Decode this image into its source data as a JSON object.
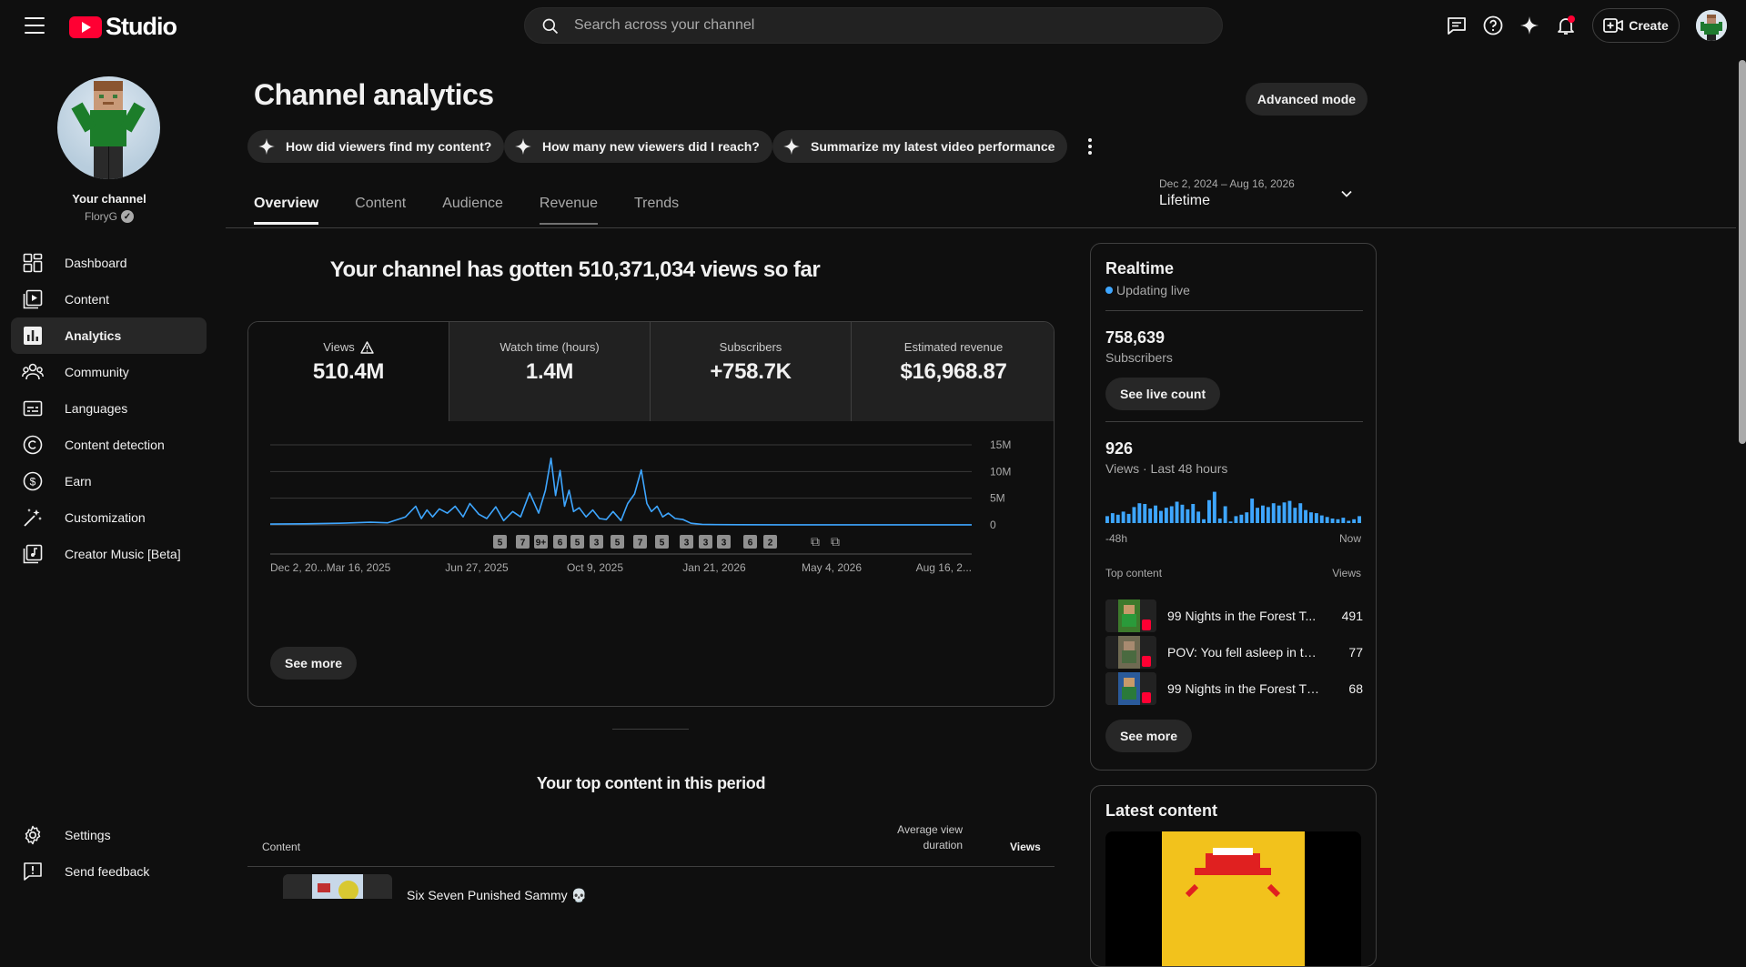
{
  "app": {
    "logo_text": "Studio",
    "search_placeholder": "Search across your channel",
    "create_label": "Create",
    "top_icons": [
      "comments-icon",
      "help-icon",
      "sparkle-icon",
      "notifications-icon"
    ]
  },
  "sidebar": {
    "channel_label": "Your channel",
    "channel_handle": "FloryG",
    "items": [
      {
        "label": "Dashboard",
        "icon": "dashboard-icon"
      },
      {
        "label": "Content",
        "icon": "content-icon"
      },
      {
        "label": "Analytics",
        "icon": "analytics-icon",
        "active": true
      },
      {
        "label": "Community",
        "icon": "community-icon"
      },
      {
        "label": "Languages",
        "icon": "languages-icon"
      },
      {
        "label": "Content detection",
        "icon": "copyright-icon"
      },
      {
        "label": "Earn",
        "icon": "earn-icon"
      },
      {
        "label": "Customization",
        "icon": "customization-icon"
      },
      {
        "label": "Creator Music [Beta]",
        "icon": "music-icon"
      }
    ],
    "bottom_items": [
      {
        "label": "Settings",
        "icon": "settings-icon"
      },
      {
        "label": "Send feedback",
        "icon": "feedback-icon"
      }
    ]
  },
  "main": {
    "title": "Channel analytics",
    "advanced_mode_label": "Advanced mode",
    "chips": [
      "How did viewers find my content?",
      "How many new viewers did I reach?",
      "Summarize my latest video performance"
    ],
    "date_range": {
      "range": "Dec 2, 2024 – Aug 16, 2026",
      "label": "Lifetime"
    },
    "tabs": [
      "Overview",
      "Content",
      "Audience",
      "Revenue",
      "Trends"
    ],
    "active_tab": "Overview",
    "headline": "Your channel has gotten 510,371,034 views so far",
    "metrics": [
      {
        "label": "Views",
        "value": "510.4M",
        "warning": true
      },
      {
        "label": "Watch time (hours)",
        "value": "1.4M"
      },
      {
        "label": "Subscribers",
        "value": "+758.7K"
      },
      {
        "label": "Estimated revenue",
        "value": "$16,968.87"
      }
    ],
    "see_more_label": "See more",
    "top_content_title": "Your top content in this period",
    "table": {
      "col_content": "Content",
      "col_avd_line1": "Average view",
      "col_avd_line2": "duration",
      "col_views": "Views",
      "first_row_title": "Six Seven Punished Sammy 💀"
    }
  },
  "realtime": {
    "title": "Realtime",
    "status": "Updating live",
    "subscribers_value": "758,639",
    "subscribers_label": "Subscribers",
    "see_live_label": "See live count",
    "views_value": "926",
    "views_label": "Views · Last 48 hours",
    "axis_start": "-48h",
    "axis_end": "Now",
    "bars": [
      0.18,
      0.26,
      0.22,
      0.3,
      0.24,
      0.42,
      0.52,
      0.5,
      0.38,
      0.46,
      0.32,
      0.4,
      0.44,
      0.56,
      0.48,
      0.36,
      0.5,
      0.3,
      0.1,
      0.6,
      0.82,
      0.12,
      0.44,
      0.04,
      0.18,
      0.22,
      0.28,
      0.64,
      0.4,
      0.46,
      0.42,
      0.52,
      0.46,
      0.54,
      0.58,
      0.4,
      0.52,
      0.34,
      0.28,
      0.26,
      0.2,
      0.16,
      0.12,
      0.1,
      0.14,
      0.06,
      0.1,
      0.18
    ],
    "top_content_label": "Top content",
    "top_views_label": "Views",
    "top_content": [
      {
        "title": "99 Nights in the Forest T...",
        "views": "491"
      },
      {
        "title": "POV: You fell asleep in the...",
        "views": "77"
      },
      {
        "title": "99 Nights in the Forest Th...",
        "views": "68"
      }
    ],
    "see_more_label": "See more"
  },
  "latest": {
    "title": "Latest content"
  },
  "chart_data": {
    "type": "line",
    "title": "",
    "xlabel": "",
    "ylabel": "",
    "ylim": [
      0,
      15000000
    ],
    "y_ticks": [
      "15M",
      "10M",
      "5M",
      "0"
    ],
    "x_ticks": [
      "Dec 2, 20...",
      "Mar 16, 2025",
      "Jun 27, 2025",
      "Oct 9, 2025",
      "Jan 21, 2026",
      "May 4, 2026",
      "Aug 16, 2..."
    ],
    "x_range": [
      "2024-12-02",
      "2026-08-16"
    ],
    "series": [
      {
        "x": [
          "2024-12-02",
          "2025-01-01",
          "2025-02-01",
          "2025-03-01",
          "2025-03-16",
          "2025-04-01",
          "2025-04-10",
          "2025-04-15",
          "2025-04-20",
          "2025-04-25",
          "2025-05-01",
          "2025-05-08",
          "2025-05-15",
          "2025-05-22",
          "2025-05-28",
          "2025-06-05",
          "2025-06-12",
          "2025-06-20",
          "2025-06-27",
          "2025-07-05",
          "2025-07-12",
          "2025-07-20",
          "2025-07-28",
          "2025-08-03",
          "2025-08-08",
          "2025-08-12",
          "2025-08-16",
          "2025-08-20",
          "2025-08-24",
          "2025-08-28",
          "2025-09-02",
          "2025-09-08",
          "2025-09-14",
          "2025-09-20",
          "2025-09-26",
          "2025-10-02",
          "2025-10-09",
          "2025-10-15",
          "2025-10-21",
          "2025-10-27",
          "2025-11-01",
          "2025-11-05",
          "2025-11-10",
          "2025-11-15",
          "2025-11-20",
          "2025-11-26",
          "2025-12-03",
          "2025-12-10",
          "2025-12-20",
          "2026-01-01",
          "2026-01-21",
          "2026-03-01",
          "2026-05-04",
          "2026-08-16"
        ],
        "values": [
          150000,
          200000,
          300000,
          500000,
          400000,
          1500000,
          3500000,
          1200000,
          2800000,
          1500000,
          3000000,
          2200000,
          3500000,
          1500000,
          4000000,
          2000000,
          1200000,
          3400000,
          800000,
          2500000,
          1500000,
          6000000,
          2200000,
          6500000,
          12500000,
          5500000,
          10200000,
          3500000,
          6500000,
          2500000,
          3200000,
          1500000,
          2800000,
          1200000,
          1000000,
          2500000,
          800000,
          4000000,
          5800000,
          10300000,
          4000000,
          2500000,
          3500000,
          1500000,
          2200000,
          1200000,
          1000000,
          300000,
          100000,
          50000,
          30000,
          20000,
          10000,
          10000
        ]
      }
    ],
    "markers": [
      "5",
      "7",
      "9+",
      "6",
      "5",
      "3",
      "5",
      "7",
      "5",
      "3",
      "3",
      "3",
      "6",
      "2"
    ],
    "grid": true
  }
}
